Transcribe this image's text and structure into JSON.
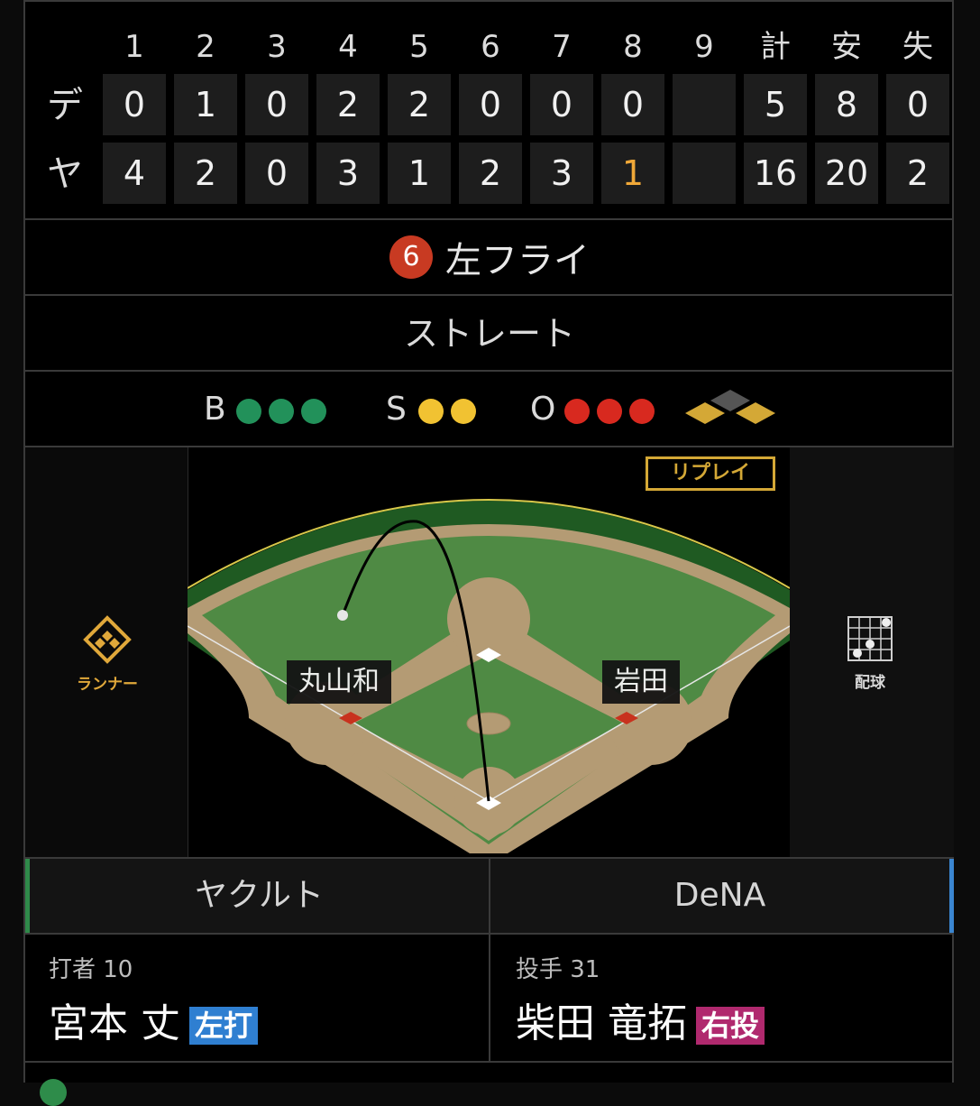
{
  "scoreboard": {
    "columns": [
      "1",
      "2",
      "3",
      "4",
      "5",
      "6",
      "7",
      "8",
      "9",
      "計",
      "安",
      "失"
    ],
    "teams": [
      {
        "abbr": "デ",
        "cells": [
          "0",
          "1",
          "0",
          "2",
          "2",
          "0",
          "0",
          "0",
          "",
          "5",
          "8",
          "0"
        ]
      },
      {
        "abbr": "ヤ",
        "cells": [
          "4",
          "2",
          "0",
          "3",
          "1",
          "2",
          "3",
          "1",
          "",
          "16",
          "20",
          "2"
        ]
      }
    ],
    "highlight_color": "#f0a838"
  },
  "play": {
    "position_number": "6",
    "result": "左フライ",
    "badge_color": "#c83a22"
  },
  "pitch": {
    "type": "ストレート"
  },
  "count": {
    "balls_label": "B",
    "balls": 3,
    "strikes_label": "S",
    "strikes": 2,
    "outs_label": "O",
    "outs": 3,
    "bases_occupied": [
      "first",
      "third"
    ]
  },
  "field": {
    "replay_label": "リプレイ",
    "runner_label": "ランナー",
    "pitch_chart_label": "配球",
    "fielders": [
      {
        "name": "丸山和"
      },
      {
        "name": "岩田"
      }
    ]
  },
  "teams": {
    "home": "ヤクルト",
    "away": "DeNA"
  },
  "batter": {
    "role": "打者 10",
    "name": "宮本 丈",
    "hand": "左打"
  },
  "pitcher": {
    "role": "投手 31",
    "name": "柴田 竜拓",
    "hand": "右投"
  }
}
